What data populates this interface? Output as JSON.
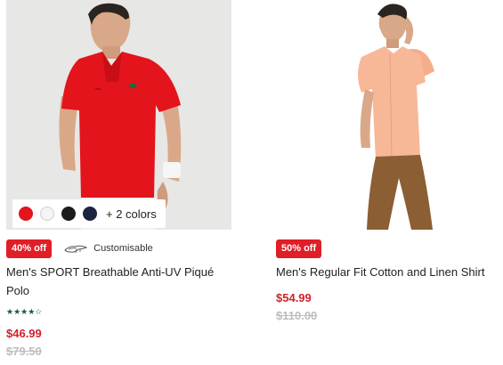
{
  "products": [
    {
      "discount": "40% off",
      "customisable": "Customisable",
      "title": "Men's SPORT Breathable Anti-UV Piqué Polo",
      "rating": "★★★★☆",
      "price": "$46.99",
      "old_price": "$79.50",
      "swatches": [
        "#e3141c",
        "#f4f4f6",
        "#1c1c1c",
        "#1c2440"
      ],
      "more_colors": "+ 2 colors",
      "image_icon": "polo-shirt-photo"
    },
    {
      "discount": "50% off",
      "title": "Men's Regular Fit Cotton and Linen Shirt",
      "price": "$54.99",
      "old_price": "$110.00",
      "image_icon": "linen-shirt-photo"
    }
  ],
  "colors": {
    "sale_red": "#e01e27",
    "price_red": "#d5202a",
    "struck_grey": "#bdbdbd",
    "star_green": "#1a5c3a"
  }
}
